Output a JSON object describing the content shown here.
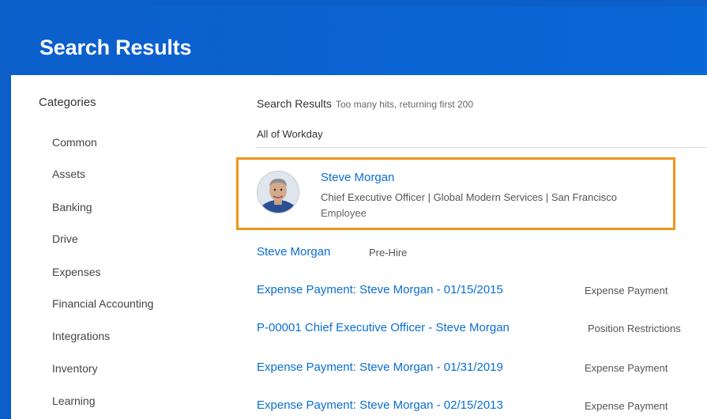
{
  "header": {
    "title": "Search Results"
  },
  "sidebar": {
    "heading": "Categories",
    "items": [
      {
        "label": "Common"
      },
      {
        "label": "Assets"
      },
      {
        "label": "Banking"
      },
      {
        "label": "Drive"
      },
      {
        "label": "Expenses"
      },
      {
        "label": "Financial Accounting"
      },
      {
        "label": "Integrations"
      },
      {
        "label": "Inventory"
      },
      {
        "label": "Learning"
      }
    ]
  },
  "results": {
    "heading": "Search Results",
    "note": "Too many hits, returning first 200",
    "scope": "All of Workday",
    "featured": {
      "name": "Steve Morgan",
      "details": "Chief Executive Officer | Global Modern Services | San Francisco",
      "type": "Employee",
      "avatar_icon": "person-photo"
    },
    "items": [
      {
        "label": "Steve Morgan",
        "type": "Pre-Hire"
      },
      {
        "label": "Expense Payment: Steve Morgan - 01/15/2015",
        "type": "Expense Payment"
      },
      {
        "label": "P-00001 Chief Executive Officer - Steve Morgan",
        "type": "Position Restrictions"
      },
      {
        "label": "Expense Payment: Steve Morgan - 01/31/2019",
        "type": "Expense Payment"
      },
      {
        "label": "Expense Payment: Steve Morgan - 02/15/2013",
        "type": "Expense Payment"
      }
    ]
  },
  "colors": {
    "header_blue": "#0b5fc7",
    "link_blue": "#0a6ed1",
    "highlight_orange": "#f0951b"
  }
}
